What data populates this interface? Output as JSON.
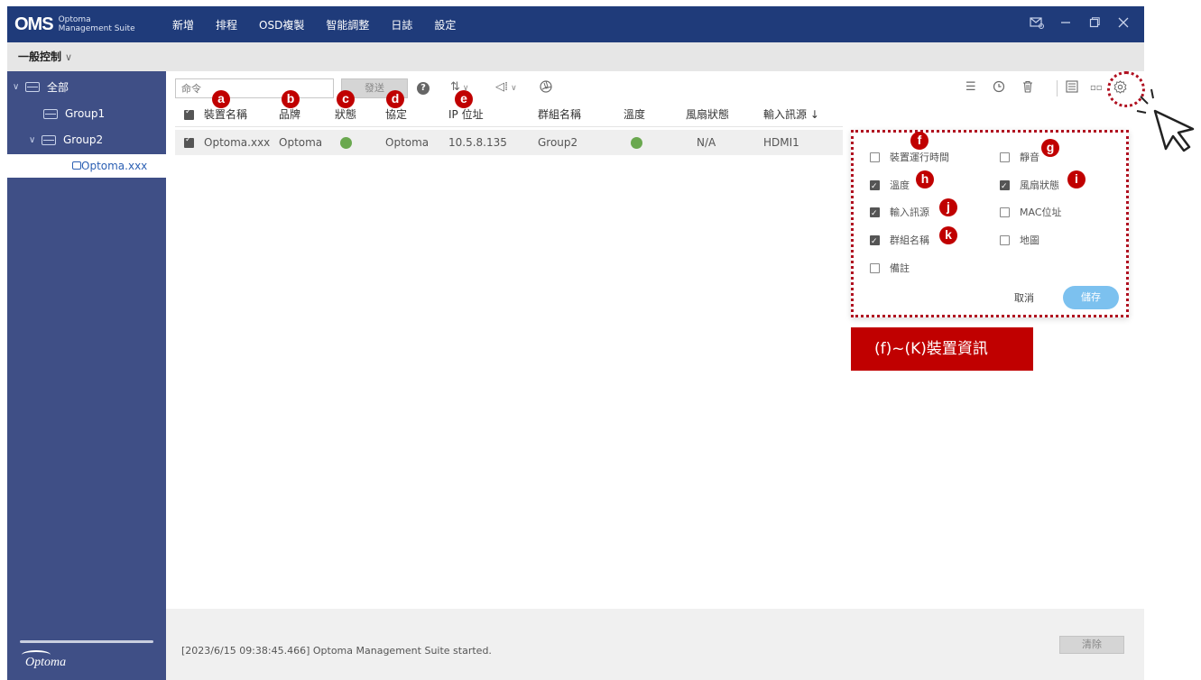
{
  "titlebar": {
    "logo": "OMS",
    "logo_line1": "Optoma",
    "logo_line2": "Management Suite",
    "menu": [
      "新增",
      "排程",
      "OSD複製",
      "智能調整",
      "日誌",
      "設定"
    ],
    "controls": [
      "mail-icon",
      "minimize-icon",
      "maximize-icon",
      "close-icon"
    ]
  },
  "subbar": {
    "mode": "一般控制",
    "mode_chevron": "∨"
  },
  "sidebar": {
    "root": "全部",
    "groups": [
      "Group1",
      "Group2"
    ],
    "selected_device": "Optoma.xxx",
    "brand": "Optoma"
  },
  "toolbar": {
    "command_placeholder": "命令",
    "send": "發送",
    "help": "?",
    "right_icons": [
      "list-icon",
      "history-icon",
      "trash-icon",
      "detail-view-icon",
      "grid-view-icon",
      "settings-gear-icon"
    ]
  },
  "table": {
    "headers": [
      "裝置名稱",
      "品牌",
      "狀態",
      "協定",
      "IP 位址",
      "群組名稱",
      "溫度",
      "風扇狀態",
      "輸入訊源 ↓"
    ],
    "rows": [
      {
        "name": "Optoma.xxx",
        "brand": "Optoma",
        "status": "green",
        "protocol": "Optoma",
        "ip": "10.5.8.135",
        "group": "Group2",
        "temp": "green",
        "fan": "N/A",
        "input": "HDMI1"
      }
    ]
  },
  "markers": [
    "a",
    "b",
    "c",
    "d",
    "e",
    "f",
    "g",
    "h",
    "i",
    "j",
    "k"
  ],
  "popup": {
    "options_left": [
      {
        "label": "裝置運行時間",
        "checked": false
      },
      {
        "label": "溫度",
        "checked": true
      },
      {
        "label": "輸入訊源",
        "checked": true
      },
      {
        "label": "群組名稱",
        "checked": true
      },
      {
        "label": "備註",
        "checked": false
      }
    ],
    "options_right": [
      {
        "label": "靜音",
        "checked": false
      },
      {
        "label": "風扇狀態",
        "checked": true
      },
      {
        "label": "MAC位址",
        "checked": false
      },
      {
        "label": "地圖",
        "checked": false
      }
    ],
    "cancel": "取消",
    "save": "儲存"
  },
  "callout": "(f)~(K)裝置資訊",
  "log": {
    "message": "[2023/6/15 09:38:45.466] Optoma Management Suite started.",
    "clear": "清除"
  },
  "colors": {
    "titlebar": "#1f3b7a",
    "sidebar": "#3f4f86",
    "marker": "#c00000",
    "status_ok": "#6aa84f",
    "save_button": "#7cc1ef"
  }
}
